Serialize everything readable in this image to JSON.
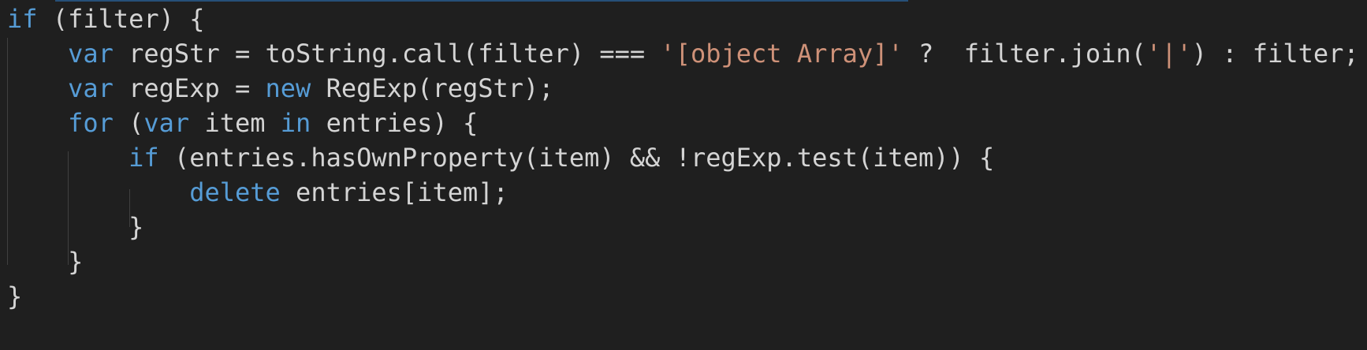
{
  "code": {
    "lines": [
      {
        "tokens": [
          {
            "text": "if",
            "type": "keyword"
          },
          {
            "text": " (filter) {",
            "type": "plain"
          }
        ]
      },
      {
        "tokens": [
          {
            "text": "    ",
            "type": "plain"
          },
          {
            "text": "var",
            "type": "keyword"
          },
          {
            "text": " regStr = toString.call(filter) === ",
            "type": "plain"
          },
          {
            "text": "'[object Array]'",
            "type": "string"
          },
          {
            "text": " ?  filter.join(",
            "type": "plain"
          },
          {
            "text": "'|'",
            "type": "string"
          },
          {
            "text": ") : filter;",
            "type": "plain"
          }
        ]
      },
      {
        "tokens": [
          {
            "text": "    ",
            "type": "plain"
          },
          {
            "text": "var",
            "type": "keyword"
          },
          {
            "text": " regExp = ",
            "type": "plain"
          },
          {
            "text": "new",
            "type": "keyword"
          },
          {
            "text": " RegExp(regStr);",
            "type": "plain"
          }
        ]
      },
      {
        "tokens": [
          {
            "text": "    ",
            "type": "plain"
          },
          {
            "text": "for",
            "type": "keyword"
          },
          {
            "text": " (",
            "type": "plain"
          },
          {
            "text": "var",
            "type": "keyword"
          },
          {
            "text": " item ",
            "type": "plain"
          },
          {
            "text": "in",
            "type": "keyword"
          },
          {
            "text": " entries) {",
            "type": "plain"
          }
        ]
      },
      {
        "tokens": [
          {
            "text": "        ",
            "type": "plain"
          },
          {
            "text": "if",
            "type": "keyword"
          },
          {
            "text": " (entries.hasOwnProperty(item) && !regExp.test(item)) {",
            "type": "plain"
          }
        ]
      },
      {
        "tokens": [
          {
            "text": "            ",
            "type": "plain"
          },
          {
            "text": "delete",
            "type": "keyword"
          },
          {
            "text": " entries[item];",
            "type": "plain"
          }
        ]
      },
      {
        "tokens": [
          {
            "text": "        }",
            "type": "plain"
          }
        ]
      },
      {
        "tokens": [
          {
            "text": "    }",
            "type": "plain"
          }
        ]
      },
      {
        "tokens": [
          {
            "text": "}",
            "type": "plain"
          }
        ]
      }
    ]
  },
  "colors": {
    "background": "#1f1f1f",
    "keyword": "#569cd6",
    "string": "#ce9178",
    "text": "#d4d4d4",
    "indent_guide": "#404040"
  }
}
